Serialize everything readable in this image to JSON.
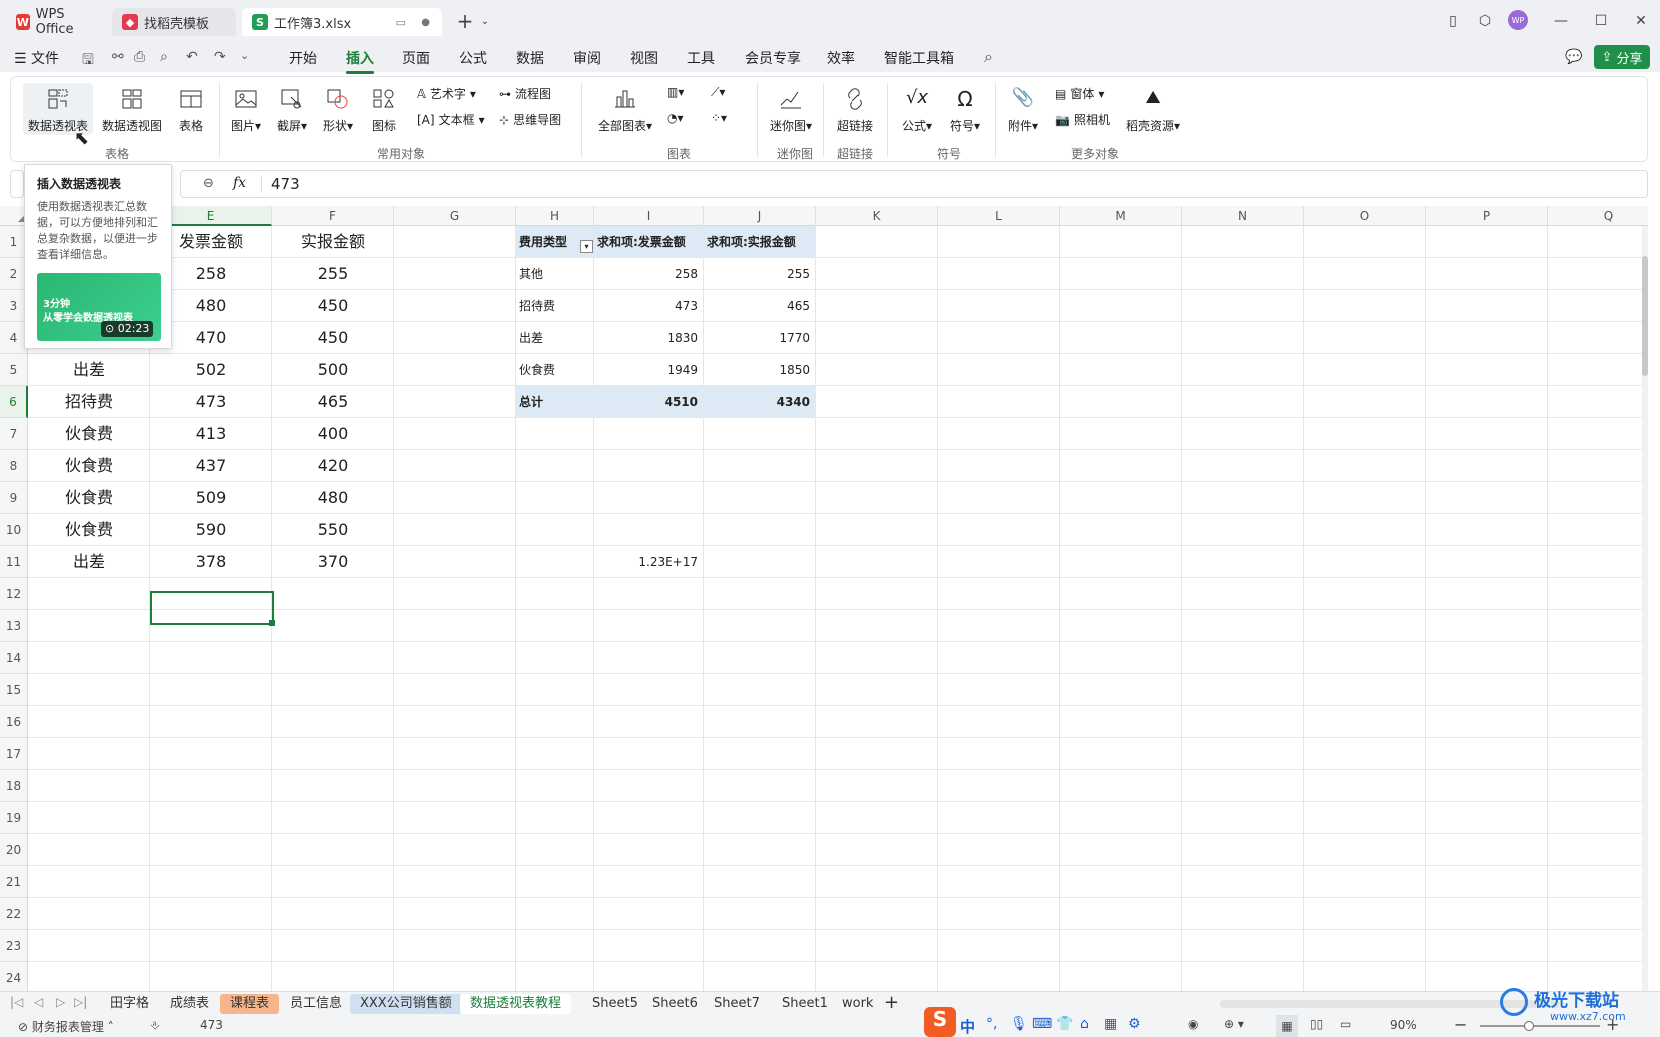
{
  "titlebar": {
    "tabs": [
      {
        "label": "WPS Office"
      },
      {
        "label": "找稻壳模板"
      },
      {
        "label": "工作簿3.xlsx"
      }
    ],
    "avatar": "WP"
  },
  "menubar": {
    "file": "文件",
    "items": [
      "开始",
      "插入",
      "页面",
      "公式",
      "数据",
      "审阅",
      "视图",
      "工具",
      "会员专享",
      "效率",
      "智能工具箱"
    ],
    "share": "分享"
  },
  "ribbon": {
    "buttons": {
      "pivot_table": "数据透视表",
      "pivot_chart": "数据透视图",
      "table": "表格",
      "picture": "图片",
      "screenshot": "截屏",
      "shape": "形状",
      "icon": "图标",
      "wordart": "艺术字",
      "textbox": "文本框",
      "flowchart": "流程图",
      "mindmap": "思维导图",
      "all_charts": "全部图表",
      "sparkline": "迷你图",
      "hyperlink": "超链接",
      "formula": "公式",
      "symbol": "符号",
      "attachment": "附件",
      "window": "窗体",
      "camera": "照相机",
      "daoke": "稻壳资源"
    },
    "groups": [
      "表格",
      "常用对象",
      "图表",
      "迷你图",
      "超链接",
      "符号",
      "更多对象"
    ]
  },
  "formula_bar": {
    "fx": "fx",
    "value": "473"
  },
  "tooltip": {
    "title": "插入数据透视表",
    "body": "使用数据透视表汇总数据，可以方便地排列和汇总复杂数据，以便进一步查看详细信息。",
    "video_title_1": "3分钟",
    "video_title_2": "从零学会数据透视表",
    "video_time": "02:23"
  },
  "grid": {
    "columns": [
      "E",
      "F",
      "G",
      "H",
      "I",
      "J",
      "K",
      "L",
      "M",
      "N",
      "O",
      "P",
      "Q"
    ],
    "rows": [
      "1",
      "2",
      "3",
      "4",
      "5",
      "6",
      "7",
      "8",
      "9",
      "10",
      "11",
      "12",
      "13",
      "14",
      "15",
      "16",
      "17",
      "18",
      "19",
      "20",
      "21",
      "22",
      "23",
      "24"
    ],
    "header_e": "发票金额",
    "header_f": "实报金额",
    "data": [
      {
        "d": "",
        "e": "258",
        "f": "255"
      },
      {
        "d": "",
        "e": "480",
        "f": "450"
      },
      {
        "d": "",
        "e": "470",
        "f": "450"
      },
      {
        "d": "出差",
        "e": "502",
        "f": "500"
      },
      {
        "d": "招待费",
        "e": "473",
        "f": "465"
      },
      {
        "d": "伙食费",
        "e": "413",
        "f": "400"
      },
      {
        "d": "伙食费",
        "e": "437",
        "f": "420"
      },
      {
        "d": "伙食费",
        "e": "509",
        "f": "480"
      },
      {
        "d": "伙食费",
        "e": "590",
        "f": "550"
      },
      {
        "d": "出差",
        "e": "378",
        "f": "370"
      }
    ],
    "pivot": {
      "headers": [
        "费用类型",
        "求和项:发票金额",
        "求和项:实报金额"
      ],
      "rows": [
        {
          "type": "其他",
          "inv": "258",
          "act": "255"
        },
        {
          "type": "招待费",
          "inv": "473",
          "act": "465"
        },
        {
          "type": "出差",
          "inv": "1830",
          "act": "1770"
        },
        {
          "type": "伙食费",
          "inv": "1949",
          "act": "1850"
        }
      ],
      "total": {
        "type": "总计",
        "inv": "4510",
        "act": "4340"
      }
    },
    "i11": "1.23E+17"
  },
  "sheets": [
    "田字格",
    "成绩表",
    "课程表",
    "员工信息",
    "XXX公司销售额",
    "数据透视表教程",
    "Sheet5",
    "Sheet6",
    "Sheet7",
    "Sheet1",
    "work"
  ],
  "status": {
    "left": "财务报表管理",
    "value": "473",
    "zoom": "90%",
    "ime": "中"
  },
  "watermark": {
    "title": "极光下载站",
    "url": "www.xz7.com"
  },
  "colors": {
    "accent": "#1b7f3a",
    "pivot_header": "#dde9f5",
    "tab_orange": "#f6b58a",
    "tab_blue": "#cfe0f3"
  }
}
